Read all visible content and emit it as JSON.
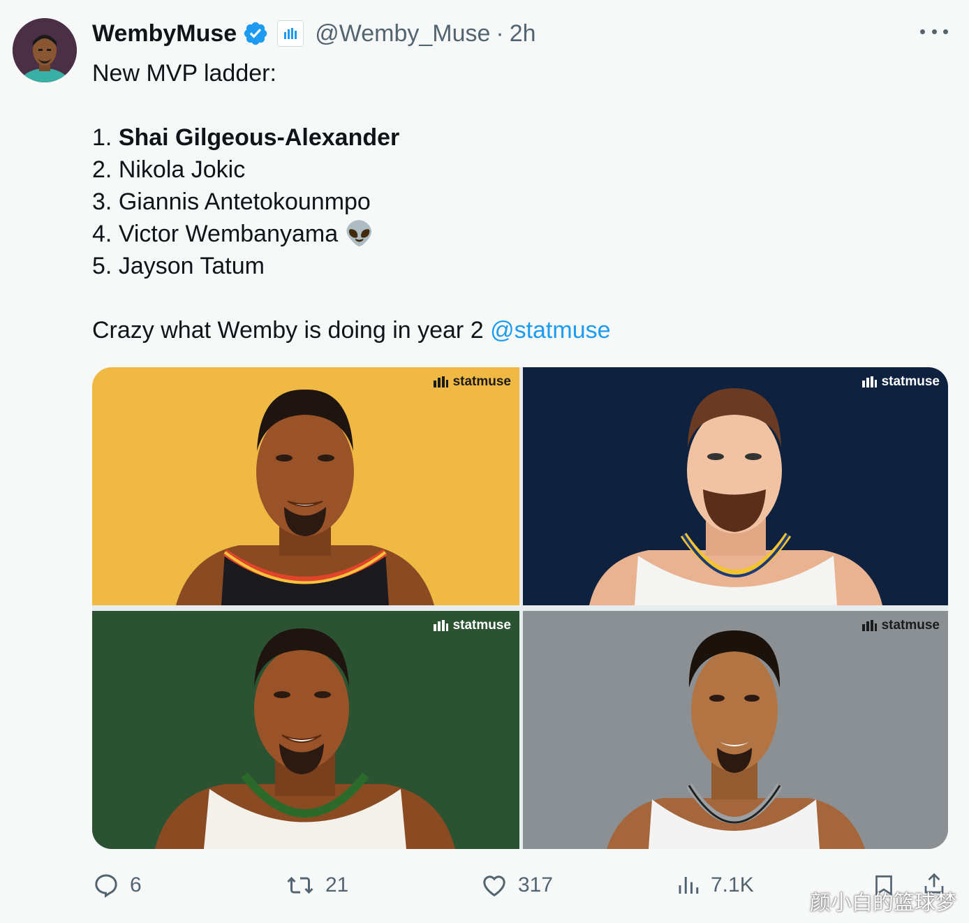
{
  "tweet": {
    "author_name": "WembyMuse",
    "handle": "@Wemby_Muse",
    "separator": "·",
    "time": "2h",
    "intro": "New MVP ladder:",
    "ladder": [
      {
        "rank": "1.",
        "name": "Shai Gilgeous-Alexander",
        "bold": true
      },
      {
        "rank": "2.",
        "name": "Nikola Jokic"
      },
      {
        "rank": "3.",
        "name": "Giannis Antetokounmpo"
      },
      {
        "rank": "4.",
        "name": "Victor Wembanyama",
        "emoji": "👽"
      },
      {
        "rank": "5.",
        "name": "Jayson Tatum"
      }
    ],
    "closing": "Crazy what Wemby is doing in year 2 ",
    "mention": "@statmuse"
  },
  "media": {
    "brand": "statmuse",
    "tiles": [
      {
        "bg": "#f0b944",
        "jersey": "black-red"
      },
      {
        "bg": "#0e2240",
        "jersey": "white-navy-gold"
      },
      {
        "bg": "#2b5231",
        "jersey": "white-green"
      },
      {
        "bg": "#8b9094",
        "jersey": "white-gray"
      }
    ]
  },
  "actions": {
    "replies": "6",
    "reposts": "21",
    "likes": "317",
    "views": "7.1K"
  },
  "watermark": "颜小白的篮球梦",
  "colors": {
    "accent": "#1d9bf0",
    "muted": "#536471",
    "text": "#0f1419"
  }
}
